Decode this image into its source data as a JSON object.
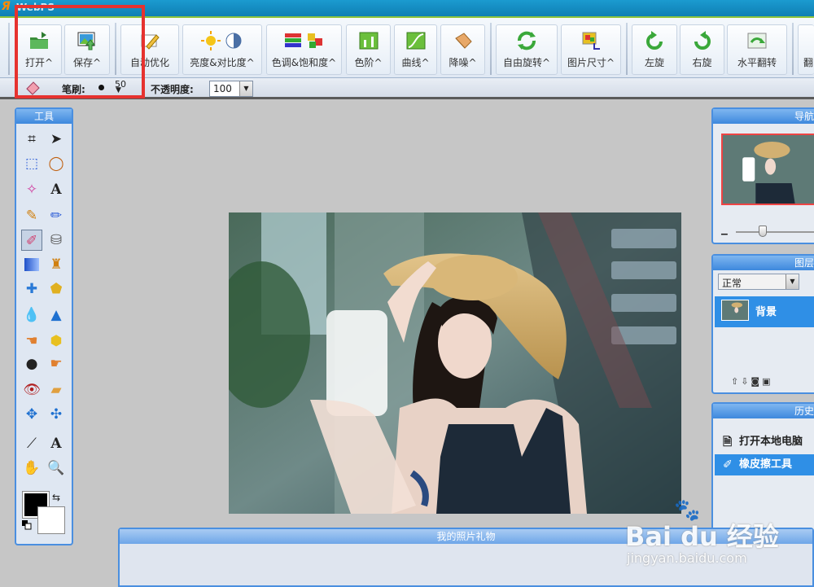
{
  "app": {
    "title": "WebPS"
  },
  "toolbar": {
    "buttons": [
      {
        "id": "open",
        "label": "打开^",
        "icon": "open-folder-icon"
      },
      {
        "id": "save",
        "label": "保存^",
        "icon": "save-image-icon"
      },
      {
        "id": "auto",
        "label": "自动优化",
        "icon": "auto-enhance-pencil-icon"
      },
      {
        "id": "bright",
        "label": "亮度&对比度^",
        "icon": "brightness-contrast-icon"
      },
      {
        "id": "hue",
        "label": "色调&饱和度^",
        "icon": "hue-saturation-icon"
      },
      {
        "id": "levels",
        "label": "色阶^",
        "icon": "levels-icon"
      },
      {
        "id": "curves",
        "label": "曲线^",
        "icon": "curves-icon"
      },
      {
        "id": "denoise",
        "label": "降噪^",
        "icon": "denoise-eraser-icon"
      },
      {
        "id": "freerot",
        "label": "自由旋转^",
        "icon": "free-rotate-icon"
      },
      {
        "id": "size",
        "label": "图片尺寸^",
        "icon": "image-size-icon"
      },
      {
        "id": "rotl",
        "label": "左旋",
        "icon": "rotate-left-icon"
      },
      {
        "id": "rotr",
        "label": "右旋",
        "icon": "rotate-right-icon"
      },
      {
        "id": "flip",
        "label": "水平翻转",
        "icon": "flip-horizontal-icon"
      },
      {
        "id": "more",
        "label": "翻",
        "icon": "more-icon"
      }
    ]
  },
  "subbar": {
    "brush_label": "笔刷:",
    "brush_size": "50",
    "opacity_label": "不透明度:",
    "opacity_value": "100"
  },
  "panels": {
    "tools_title": "工具",
    "navigator_title": "导航",
    "layers_title": "图层",
    "blend_mode": "正常",
    "layer_name": "背景",
    "history_title": "历史记",
    "history_items": [
      "打开本地电脑",
      "橡皮擦工具"
    ],
    "gift_title": "我的照片礼物"
  },
  "watermark": {
    "brand": "Bai du 经验",
    "url": "jingyan.baidu.com"
  },
  "colors": {
    "accent": "#4a8fe0",
    "highlight": "#e6322f",
    "selected": "#2f8fe6"
  }
}
